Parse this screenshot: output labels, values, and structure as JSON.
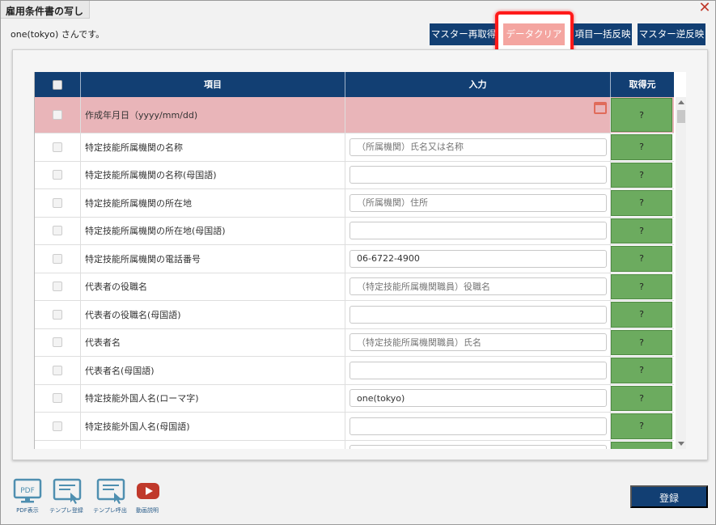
{
  "window": {
    "title": "雇用条件書の写し"
  },
  "user_text": "one(tokyo) さんです。",
  "toolbar": {
    "master_refetch": "マスター再取得",
    "data_clear": "データクリア",
    "bulk_reflect": "項目一括反映",
    "master_reverse": "マスター逆反映"
  },
  "table": {
    "headers": {
      "item": "項目",
      "input": "入力",
      "source": "取得元"
    },
    "rows": [
      {
        "label": "作成年月日（yyyy/mm/dd)",
        "value": "",
        "placeholder": "",
        "source": "?"
      },
      {
        "label": "特定技能所属機関の名称",
        "value": "",
        "placeholder": "（所属機関）氏名又は名称",
        "source": "?"
      },
      {
        "label": "特定技能所属機関の名称(母国語)",
        "value": "",
        "placeholder": "",
        "source": "?"
      },
      {
        "label": "特定技能所属機関の所在地",
        "value": "",
        "placeholder": "（所属機関）住所",
        "source": "?"
      },
      {
        "label": "特定技能所属機関の所在地(母国語)",
        "value": "",
        "placeholder": "",
        "source": "?"
      },
      {
        "label": "特定技能所属機関の電話番号",
        "value": "06-6722-4900",
        "placeholder": "",
        "source": "?"
      },
      {
        "label": "代表者の役職名",
        "value": "",
        "placeholder": "（特定技能所属機関職員）役職名",
        "source": "?"
      },
      {
        "label": "代表者の役職名(母国語)",
        "value": "",
        "placeholder": "",
        "source": "?"
      },
      {
        "label": "代表者名",
        "value": "",
        "placeholder": "（特定技能所属機関職員）氏名",
        "source": "?"
      },
      {
        "label": "代表者名(母国語)",
        "value": "",
        "placeholder": "",
        "source": "?"
      },
      {
        "label": "特定技能外国人名(ローマ字)",
        "value": "one(tokyo)",
        "placeholder": "",
        "source": "?"
      },
      {
        "label": "特定技能外国人名(母国語)",
        "value": "",
        "placeholder": "",
        "source": "?"
      }
    ]
  },
  "footer": {
    "pdf_label": "PDF表示",
    "template_save_label": "テンプレ登録",
    "template_load_label": "テンプレ呼出",
    "video_label": "動画説明",
    "register_label": "登録"
  },
  "colors": {
    "primary": "#123f73",
    "highlight_border": "#ff1a1a",
    "clear_button": "#f4a5a0",
    "source_cell": "#6cab5f",
    "first_row": "#e9b5b9"
  }
}
